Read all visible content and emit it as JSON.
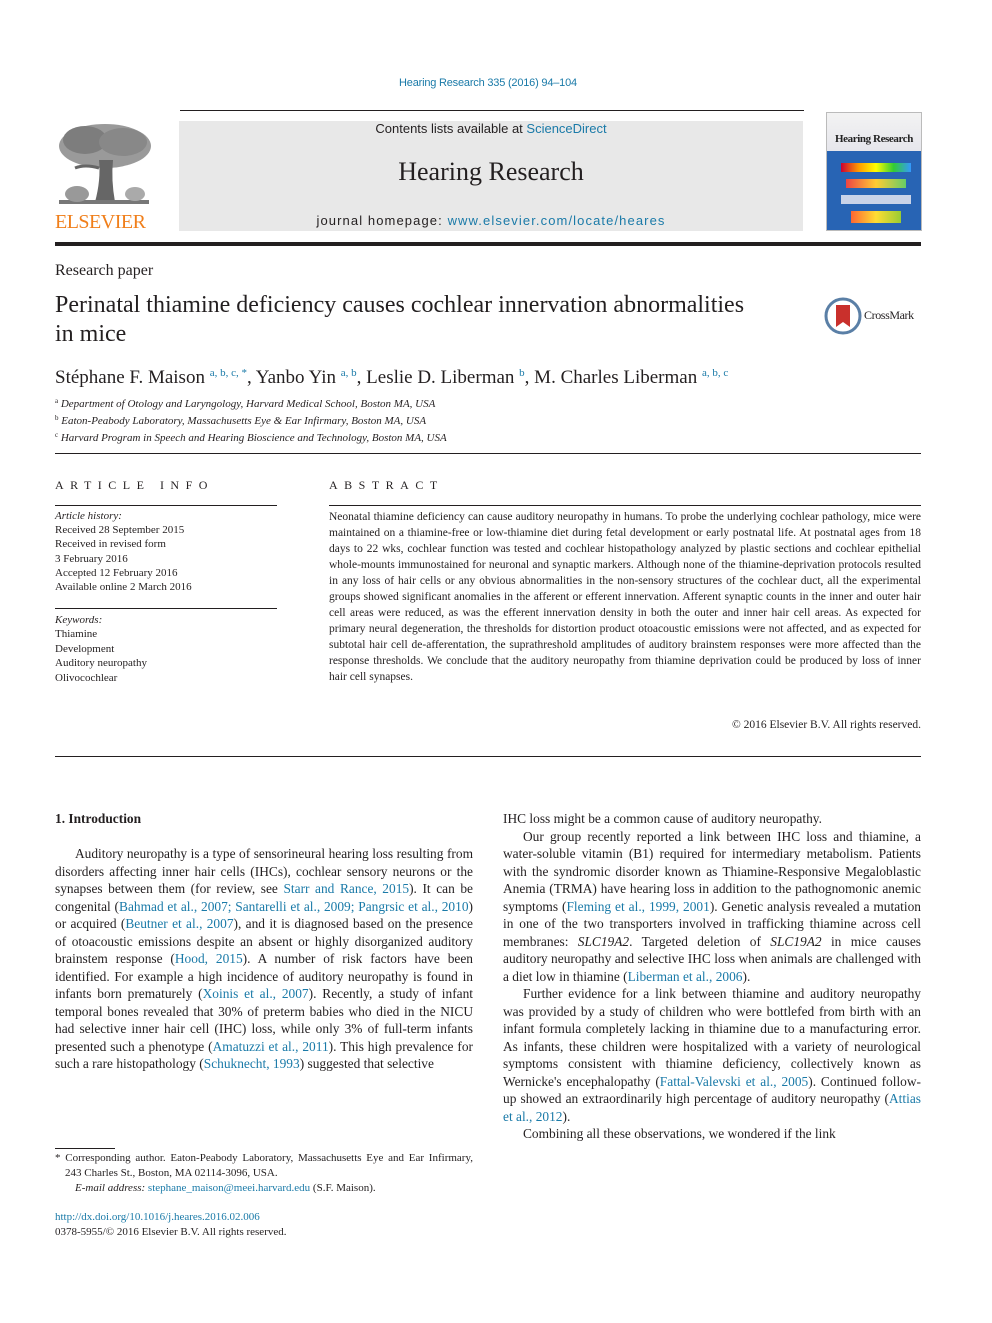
{
  "header": {
    "citation": "Hearing Research 335 (2016) 94–104",
    "publisher_logo_text": "ELSEVIER",
    "contents_prefix": "Contents lists available at ",
    "contents_link": "ScienceDirect",
    "journal_title": "Hearing Research",
    "homepage_prefix": "journal homepage: ",
    "homepage_link": "www.elsevier.com/locate/heares",
    "cover_title": "Hearing Research"
  },
  "article": {
    "type": "Research paper",
    "title": "Perinatal thiamine deficiency causes cochlear innervation abnormalities in mice",
    "crossmark_label": "CrossMark",
    "authors": [
      {
        "name": "Stéphane F. Maison",
        "affils": "a, b, c, *"
      },
      {
        "name": "Yanbo Yin",
        "affils": "a, b"
      },
      {
        "name": "Leslie D. Liberman",
        "affils": "b"
      },
      {
        "name": "M. Charles Liberman",
        "affils": "a, b, c"
      }
    ],
    "affiliations": [
      {
        "key": "a",
        "text": "Department of Otology and Laryngology, Harvard Medical School, Boston MA, USA"
      },
      {
        "key": "b",
        "text": "Eaton-Peabody Laboratory, Massachusetts Eye & Ear Infirmary, Boston MA, USA"
      },
      {
        "key": "c",
        "text": "Harvard Program in Speech and Hearing Bioscience and Technology, Boston MA, USA"
      }
    ]
  },
  "article_info": {
    "heading": "ARTICLE INFO",
    "history_label": "Article history:",
    "history": [
      "Received 28 September 2015",
      "Received in revised form",
      "3 February 2016",
      "Accepted 12 February 2016",
      "Available online 2 March 2016"
    ],
    "keywords_label": "Keywords:",
    "keywords": [
      "Thiamine",
      "Development",
      "Auditory neuropathy",
      "Olivocochlear"
    ]
  },
  "abstract": {
    "heading": "ABSTRACT",
    "text": "Neonatal thiamine deficiency can cause auditory neuropathy in humans. To probe the underlying cochlear pathology, mice were maintained on a thiamine-free or low-thiamine diet during fetal devel­opment or early postnatal life. At postnatal ages from 18 days to 22 wks, cochlear function was tested and cochlear histopathology analyzed by plastic sections and cochlear epithelial whole-mounts immuno­stained for neuronal and synaptic markers. Although none of the thiamine-deprivation protocols resulted in any loss of hair cells or any obvious abnormalities in the non-sensory structures of the cochlear duct, all the experimental groups showed significant anomalies in the afferent or efferent innervation. Afferent synaptic counts in the inner and outer hair cell areas were reduced, as was the efferent innervation density in both the outer and inner hair cell areas. As expected for primary neural degeneration, the thresholds for distortion product otoacoustic emissions were not affected, and as expected for subtotal hair cell de-afferentation, the suprathreshold amplitudes of auditory brainstem responses were more affected than the response thresholds. We conclude that the auditory neuropathy from thiamine deprivation could be produced by loss of inner hair cell synapses.",
    "copyright": "© 2016 Elsevier B.V. All rights reserved."
  },
  "body": {
    "section_heading": "1.  Introduction",
    "left_paragraphs": [
      [
        {
          "t": "Auditory neuropathy is a type of sensorineural hearing loss resulting from disorders affecting inner hair cells (IHCs), cochlear sensory neurons or the synapses between them (for review, see "
        },
        {
          "t": "Starr and Rance, 2015",
          "link": true
        },
        {
          "t": "). It can be congenital ("
        },
        {
          "t": "Bahmad et al., 2007; Santarelli et al., 2009; Pangrsic et al., 2010",
          "link": true
        },
        {
          "t": ") or acquired ("
        },
        {
          "t": "Beutner et al., 2007",
          "link": true
        },
        {
          "t": "), and it is diagnosed based on the presence of otoa­coustic emissions despite an absent or highly disorganized auditory brainstem response ("
        },
        {
          "t": "Hood, 2015",
          "link": true
        },
        {
          "t": "). A number of risk factors have been identified. For example a high incidence of auditory neurop­athy is found in infants born prematurely ("
        },
        {
          "t": "Xoinis et al., 2007",
          "link": true
        },
        {
          "t": "). Recently, a study of infant temporal bones revealed that 30% of preterm babies who died in the NICU had selective inner hair cell (IHC) loss, while only 3% of full-term infants presented such a phenotype ("
        },
        {
          "t": "Amatuzzi et al., 2011",
          "link": true
        },
        {
          "t": "). This high prevalence for such a rare histopathology ("
        },
        {
          "t": "Schuknecht, 1993",
          "link": true
        },
        {
          "t": ") suggested that selective"
        }
      ]
    ],
    "right_paragraphs": [
      [
        {
          "t": "IHC loss might be a common cause of auditory neuropathy."
        }
      ],
      [
        {
          "t": "Our group recently reported a link between IHC loss and thiamine, a water-soluble vitamin (B1) required for intermediary metabolism. Patients with the syndromic disorder known as Thiamine-Responsive Megaloblastic Anemia (TRMA) have hearing loss in addition to the pathognomonic anemic symptoms ("
        },
        {
          "t": "Fleming et al., 1999, 2001",
          "link": true
        },
        {
          "t": "). Genetic analysis revealed a mutation in one of the two transporters involved in trafficking thiamine across cell membranes: "
        },
        {
          "t": "SLC19A2",
          "italic": true
        },
        {
          "t": ". Targeted deletion of "
        },
        {
          "t": "SLC19A2",
          "italic": true
        },
        {
          "t": " in mice causes auditory neuropathy and selective IHC loss when animals are challenged with a diet low in thiamine ("
        },
        {
          "t": "Liberman et al., 2006",
          "link": true
        },
        {
          "t": ")."
        }
      ],
      [
        {
          "t": "Further evidence for a link between thiamine and auditory neuropathy was provided by a study of children who were bottle­fed from birth with an infant formula completely lacking in thia­mine due to a manufacturing error. As infants, these children were hospitalized with a variety of neurological symptoms consistent with thiamine deficiency, collectively known as Wernicke's en­cephalopathy ("
        },
        {
          "t": "Fattal-Valevski et al., 2005",
          "link": true
        },
        {
          "t": "). Continued follow-up showed an extraordinarily high percentage of auditory neuropa­thy ("
        },
        {
          "t": "Attias et al., 2012",
          "link": true
        },
        {
          "t": ")."
        }
      ],
      [
        {
          "t": "Combining all these observations, we wondered if the link"
        }
      ]
    ]
  },
  "footnote": {
    "corresponding": "* Corresponding author. Eaton-Peabody Laboratory, Massachusetts Eye and Ear Infirmary, 243 Charles St., Boston, MA 02114-3096, USA.",
    "email_label": "E-mail address: ",
    "email": "stephane_maison@meei.harvard.edu",
    "email_suffix": " (S.F. Maison).",
    "doi": "http://dx.doi.org/10.1016/j.heares.2016.02.006",
    "issn_copyright": "0378-5955/© 2016 Elsevier B.V. All rights reserved."
  },
  "colors": {
    "link": "#1a7aa8",
    "elsevier_orange": "#f07f1b",
    "banner_gray": "#e8e8e8",
    "text": "#231f20"
  }
}
